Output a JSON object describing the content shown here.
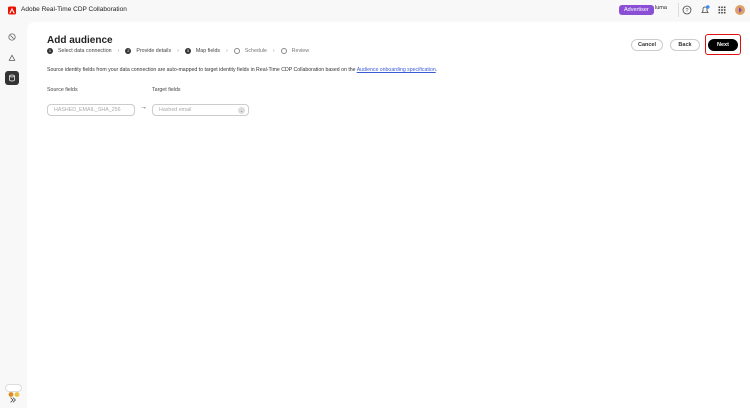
{
  "app": {
    "title": "Adobe Real-Time CDP Collaboration",
    "role_badge": "Advertiser",
    "user": "luma"
  },
  "colors": {
    "accent": "#8b4fd6",
    "link": "#3b5bd6",
    "highlight": "#e01010"
  },
  "page": {
    "title": "Add audience",
    "steps": [
      {
        "num": "1",
        "label": "Select data connection",
        "state": "done"
      },
      {
        "num": "2",
        "label": "Provide details",
        "state": "done"
      },
      {
        "num": "3",
        "label": "Map fields",
        "state": "current"
      },
      {
        "num": "",
        "label": "Schedule",
        "state": "future"
      },
      {
        "num": "",
        "label": "Review",
        "state": "future"
      }
    ],
    "description": "Source identity fields from your data connection are auto-mapped to target identity fields in Real-Time CDP Collaboration based on the ",
    "description_link": "Audience onboarding specification",
    "description_end": ".",
    "source_label": "Source fields",
    "target_label": "Target fields",
    "source_value": "HASHED_EMAIL_SHA_256",
    "target_placeholder": "Hashed email",
    "arrow": "→",
    "buttons": {
      "cancel": "Cancel",
      "back": "Back",
      "next": "Next"
    }
  },
  "icons": {
    "help": "help-icon",
    "notifications": "bell-icon",
    "apps": "grid-icon",
    "avatar": "avatar-icon"
  }
}
